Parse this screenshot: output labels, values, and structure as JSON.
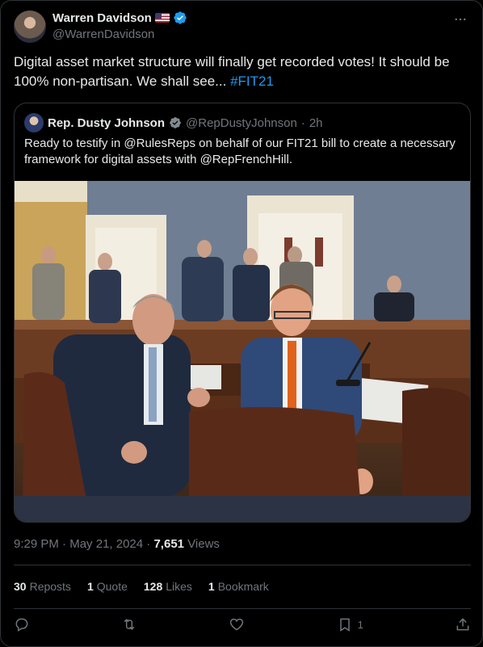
{
  "author": {
    "display_name": "Warren Davidson",
    "handle": "@WarrenDavidson",
    "flag": "🇺🇸",
    "verified_color": "#1d9bf0"
  },
  "tweet": {
    "text_before": "Digital asset market structure will finally get recorded votes! It should be 100% non-partisan. We shall see... ",
    "hashtag": "#FIT21"
  },
  "quote": {
    "display_name": "Rep. Dusty Johnson",
    "handle": "@RepDustyJohnson",
    "separator": "·",
    "time": "2h",
    "text": "Ready to testify in @RulesReps on behalf of our FIT21 bill to create a necessary framework for digital assets with @RepFrenchHill."
  },
  "meta": {
    "time": "9:29 PM",
    "separator": "·",
    "date": "May 21, 2024",
    "views_count": "7,651",
    "views_label": "Views"
  },
  "stats": {
    "reposts_count": "30",
    "reposts_label": "Reposts",
    "quotes_count": "1",
    "quotes_label": "Quote",
    "likes_count": "128",
    "likes_label": "Likes",
    "bookmarks_count": "1",
    "bookmarks_label": "Bookmark"
  },
  "actions": {
    "bookmark_count": "1"
  },
  "colors": {
    "background": "#000000",
    "text": "#e7e9ea",
    "muted": "#71767b",
    "accent": "#1d9bf0",
    "border": "#2f3336"
  }
}
